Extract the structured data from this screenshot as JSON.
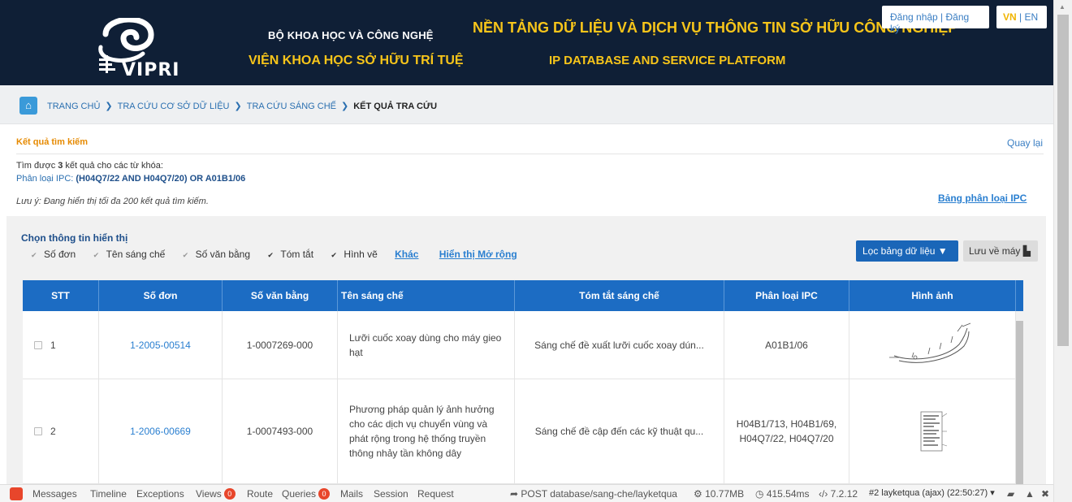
{
  "header": {
    "logo_text": "VIPRI",
    "org_line1": "BỘ KHOA HỌC VÀ CÔNG NGHỆ",
    "org_line2": "VIỆN KHOA HỌC SỞ HỮU TRÍ TUỆ",
    "platform_line1": "NỀN TẢNG DỮ LIỆU VÀ DỊCH VỤ THÔNG TIN SỞ HỮU CÔNG NGHIỆP",
    "platform_line2": "IP DATABASE AND SERVICE PLATFORM",
    "login": "Đăng nhập",
    "auth_sep": " | ",
    "register": "Đăng ký",
    "lang_vn": "VN",
    "lang_sep": " | ",
    "lang_en": "EN"
  },
  "breadcrumb": {
    "home_icon": "home-icon",
    "items": [
      "TRANG CHỦ",
      "TRA CỨU CƠ SỞ DỮ LIỆU",
      "TRA CỨU SÁNG CHẾ"
    ],
    "separator": "❯",
    "current": "KẾT QUẢ TRA CỨU"
  },
  "results": {
    "title": "Kết quả tìm kiếm",
    "back": "Quay lại",
    "found_prefix": "Tìm được ",
    "found_count": "3",
    "found_suffix": " kết quả cho các từ khóa:",
    "ipc_label": "Phân loại IPC: ",
    "ipc_query": "(H04Q7/22 AND H04Q7/20) OR A01B1/06",
    "note": "Lưu ý: Đang hiển thị tối đa 200 kết quả tìm kiếm.",
    "ipc_table_link": "Bảng phân loại IPC"
  },
  "display_options": {
    "title": "Chọn thông tin hiển thị",
    "options": [
      {
        "label": "Số đơn",
        "checked": true,
        "disabled": true
      },
      {
        "label": "Tên sáng chế",
        "checked": true,
        "disabled": true
      },
      {
        "label": "Số văn bằng",
        "checked": true,
        "disabled": true
      },
      {
        "label": "Tóm tắt",
        "checked": true,
        "disabled": false
      },
      {
        "label": "Hình vẽ",
        "checked": true,
        "disabled": false
      }
    ],
    "other_link": "Khác",
    "expand_link": "Hiển thị Mở rộng",
    "filter_button": "Lọc bảng dữ liệu",
    "save_button": "Lưu về máy"
  },
  "table": {
    "headers": [
      "STT",
      "Số đơn",
      "Số văn bằng",
      "Tên sáng chế",
      "Tóm tắt sáng chế",
      "Phân loại IPC",
      "Hình ảnh"
    ],
    "rows": [
      {
        "stt": "1",
        "app_no": "1-2005-00514",
        "patent_no": "1-0007269-000",
        "title": "Lưỡi cuốc xoay dùng cho máy gieo hạt",
        "abstract": "Sáng chế đề xuất lưỡi cuốc xoay dún...",
        "ipc": "A01B1/06"
      },
      {
        "stt": "2",
        "app_no": "1-2006-00669",
        "patent_no": "1-0007493-000",
        "title": "Phương pháp quản lý ảnh hưởng cho các dịch vụ chuyển vùng và phát rộng trong hệ thống truyền thông nhảy tần không dây",
        "abstract": "Sáng chế đề cập đến các kỹ thuật qu...",
        "ipc": "H04B1/713, H04B1/69, H04Q7/22, H04Q7/20"
      }
    ]
  },
  "debugbar": {
    "tabs": [
      "Messages",
      "Timeline",
      "Exceptions",
      "Views",
      "Route",
      "Queries",
      "Mails",
      "Session",
      "Request"
    ],
    "views_count": "0",
    "queries_count": "0",
    "route": "POST database/sang-che/layketqua",
    "memory": "10.77MB",
    "time": "415.54ms",
    "php": "7.2.12",
    "request": "#2 layketqua (ajax) (22:50:27)"
  },
  "colors": {
    "header_bg": "#0f1f36",
    "accent_yellow": "#f7c51a",
    "table_header": "#1c6cc3",
    "link_blue": "#2a7fd0"
  }
}
